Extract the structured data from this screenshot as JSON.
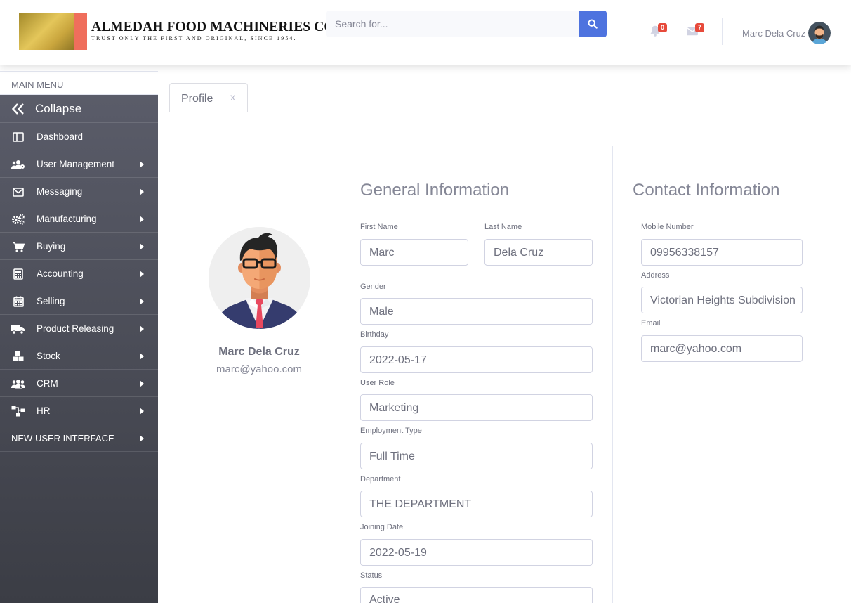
{
  "brand": {
    "title": "ALMEDAH FOOD MACHINERIES CORP",
    "tagline": "TRUST ONLY THE FIRST AND ORIGINAL, SINCE 1954."
  },
  "search": {
    "placeholder": "Search for...",
    "value": ""
  },
  "alerts": {
    "count": "0"
  },
  "messages": {
    "count": "7"
  },
  "user": {
    "name": "Marc Dela Cruz"
  },
  "sidebar": {
    "header": "MAIN MENU",
    "collapse": "Collapse",
    "items": [
      {
        "label": "Dashboard",
        "icon": "dashboard-icon"
      },
      {
        "label": "User Management",
        "icon": "users-cog-icon"
      },
      {
        "label": "Messaging",
        "icon": "envelope-icon"
      },
      {
        "label": "Manufacturing",
        "icon": "cogs-icon"
      },
      {
        "label": "Buying",
        "icon": "cart-icon"
      },
      {
        "label": "Accounting",
        "icon": "calculator-icon"
      },
      {
        "label": "Selling",
        "icon": "calendar-icon"
      },
      {
        "label": "Product Releasing",
        "icon": "truck-icon"
      },
      {
        "label": "Stock",
        "icon": "boxes-icon"
      },
      {
        "label": "CRM",
        "icon": "users-icon"
      },
      {
        "label": "HR",
        "icon": "sitemap-icon"
      },
      {
        "label": "NEW USER INTERFACE",
        "icon": ""
      }
    ]
  },
  "tab": {
    "label": "Profile",
    "close": "x"
  },
  "profile": {
    "name": "Marc Dela Cruz",
    "email": "marc@yahoo.com"
  },
  "general": {
    "title": "General Information",
    "first_name": {
      "label": "First Name",
      "value": "Marc"
    },
    "last_name": {
      "label": "Last Name",
      "value": "Dela Cruz"
    },
    "gender": {
      "label": "Gender",
      "value": "Male"
    },
    "birthday": {
      "label": "Birthday",
      "value": "2022-05-17"
    },
    "user_role": {
      "label": "User Role",
      "value": "Marketing"
    },
    "employment_type": {
      "label": "Employment Type",
      "value": "Full Time"
    },
    "department": {
      "label": "Department",
      "value": "THE DEPARTMENT"
    },
    "joining_date": {
      "label": "Joining Date",
      "value": "2022-05-19"
    },
    "status": {
      "label": "Status",
      "value": "Active"
    }
  },
  "contact": {
    "title": "Contact Information",
    "mobile": {
      "label": "Mobile Number",
      "value": "09956338157"
    },
    "address": {
      "label": "Address",
      "value": "Victorian Heights Subdivision"
    },
    "email": {
      "label": "Email",
      "value": "marc@yahoo.com"
    }
  },
  "colors": {
    "primary": "#4e73df",
    "badge": "#e74a3b",
    "sidebar": "#5a5c69"
  }
}
